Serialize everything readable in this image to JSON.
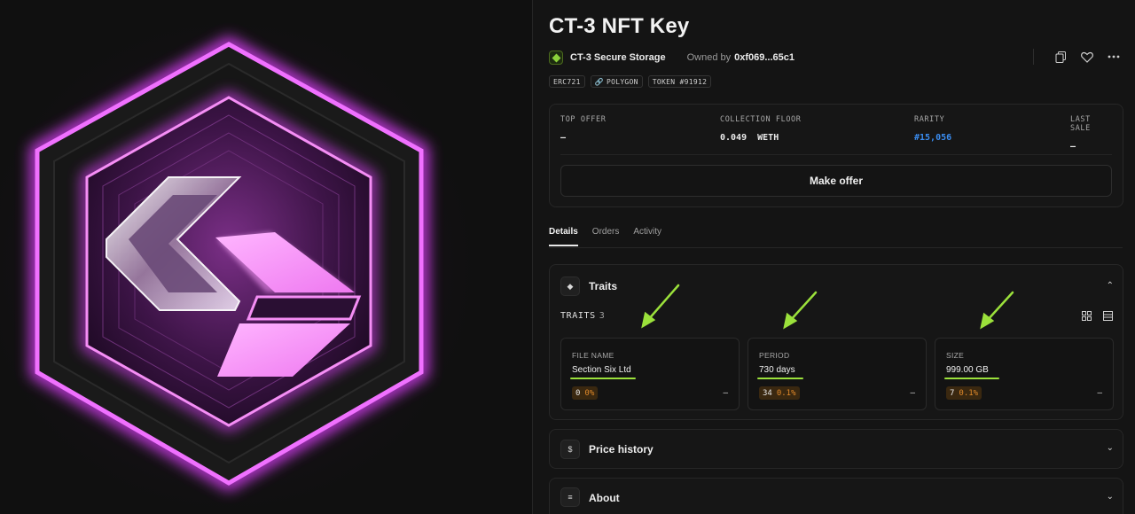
{
  "art": {
    "colors": {
      "glow": "#e040ff",
      "pink": "#f58ef5",
      "panel": "#2a0f33"
    }
  },
  "header": {
    "title": "CT-3 NFT Key",
    "collection_name": "CT-3 Secure Storage",
    "owned_by_label": "Owned by",
    "owner": "0xf069...65c1"
  },
  "chips": [
    "ERC721",
    "POLYGON",
    "TOKEN #91912"
  ],
  "stats": [
    {
      "label": "TOP OFFER",
      "value": "–"
    },
    {
      "label": "COLLECTION FLOOR",
      "value": "0.049  WETH"
    },
    {
      "label": "RARITY",
      "value": "#15,056"
    },
    {
      "label": "LAST SALE",
      "value": "–"
    }
  ],
  "make_offer_label": "Make offer",
  "tabs": [
    {
      "label": "Details",
      "active": true
    },
    {
      "label": "Orders",
      "active": false
    },
    {
      "label": "Activity",
      "active": false
    }
  ],
  "traits": {
    "section_title": "Traits",
    "count_label": "TRAITS",
    "count": "3",
    "items": [
      {
        "label": "FILE NAME",
        "value": "Section Six Ltd",
        "badge_count": "0",
        "badge_pct": "0%",
        "dash": "–"
      },
      {
        "label": "PERIOD",
        "value": "730 days",
        "badge_count": "34",
        "badge_pct": "0.1%",
        "dash": "–"
      },
      {
        "label": "SIZE",
        "value": "999.00 GB",
        "badge_count": "7",
        "badge_pct": "0.1%",
        "dash": "–"
      }
    ]
  },
  "price_history_title": "Price history",
  "about_title": "About",
  "colors": {
    "accent_blue": "#3a8cf0",
    "annotation_green": "#9be13b",
    "badge_orange": "#e0892a"
  }
}
